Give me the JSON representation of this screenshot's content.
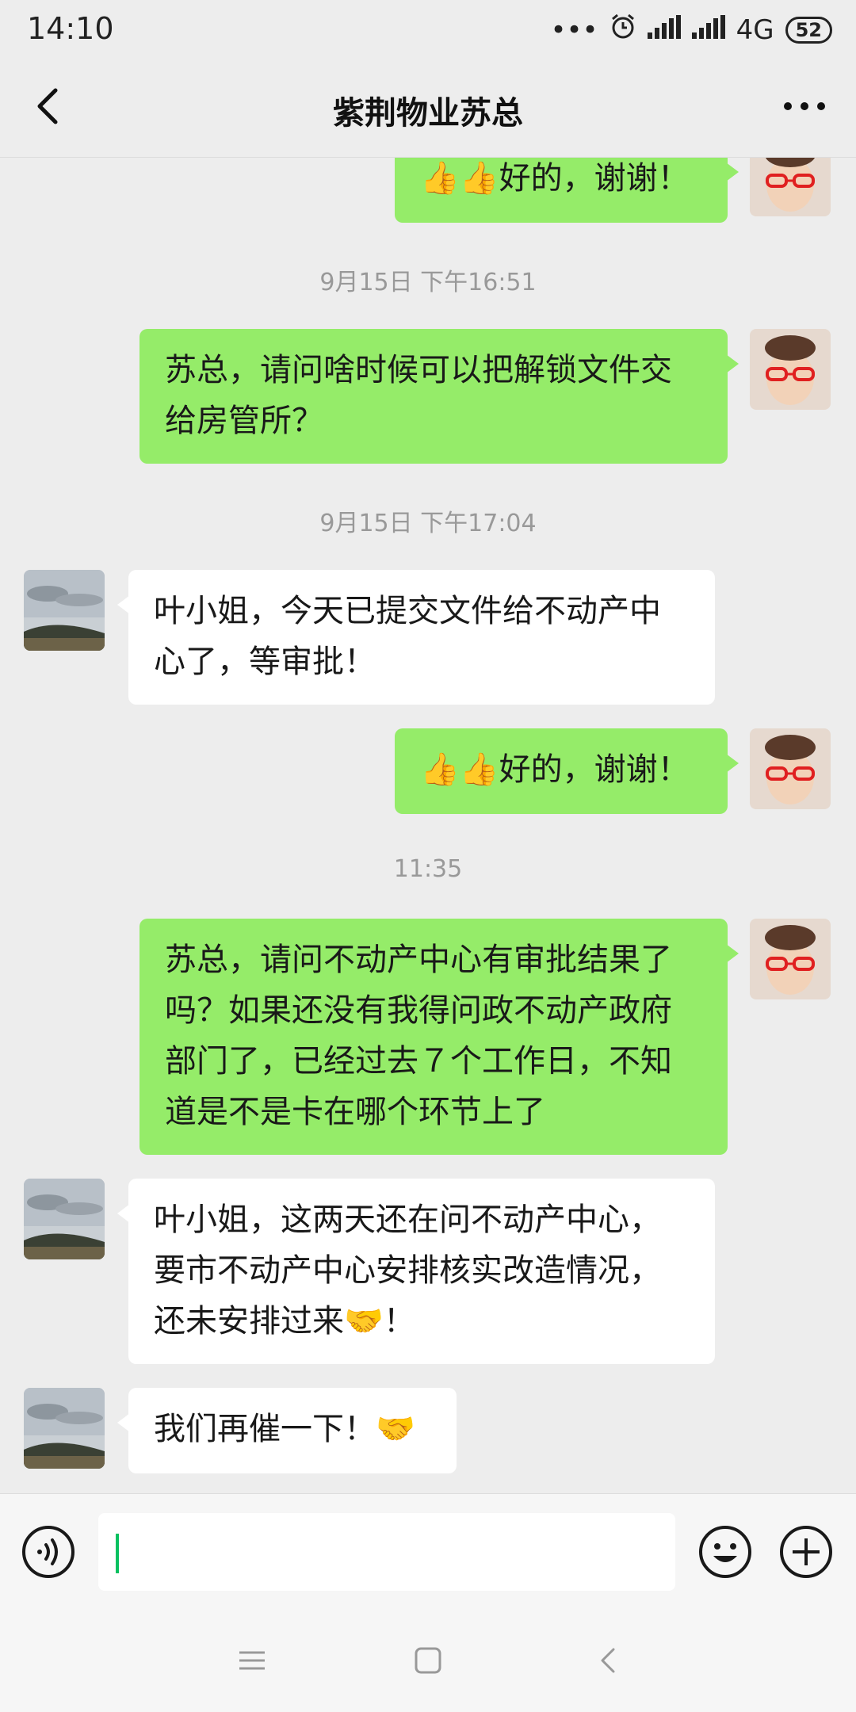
{
  "status_bar": {
    "time": "14:10",
    "network": "4G",
    "battery": "52"
  },
  "header": {
    "title": "紫荆物业苏总"
  },
  "messages": [
    {
      "side": "out",
      "text": "👍👍好的，谢谢！"
    },
    {
      "timestamp": "9月15日 下午16:51"
    },
    {
      "side": "out",
      "text": "苏总，请问啥时候可以把解锁文件交给房管所？"
    },
    {
      "timestamp": "9月15日 下午17:04"
    },
    {
      "side": "in",
      "text": "叶小姐，今天已提交文件给不动产中心了，等审批！"
    },
    {
      "side": "out",
      "text": "👍👍好的，谢谢！"
    },
    {
      "timestamp": "11:35"
    },
    {
      "side": "out",
      "text": "苏总，请问不动产中心有审批结果了吗？如果还没有我得问政不动产政府部门了，已经过去７个工作日，不知道是不是卡在哪个环节上了"
    },
    {
      "side": "in",
      "text": "叶小姐，这两天还在问不动产中心，要市不动产中心安排核实改造情况，还未安排过来🤝！"
    },
    {
      "side": "in",
      "text": "我们再催一下！🤝"
    }
  ],
  "input": {
    "value": ""
  },
  "colors": {
    "outgoing_bubble": "#95ec69",
    "incoming_bubble": "#ffffff",
    "background": "#ededed",
    "cursor": "#07c160"
  },
  "icons": [
    "back-arrow-icon",
    "more-dots-icon",
    "voice-icon",
    "emoji-icon",
    "plus-icon",
    "menu-icon",
    "home-icon",
    "back-icon"
  ]
}
